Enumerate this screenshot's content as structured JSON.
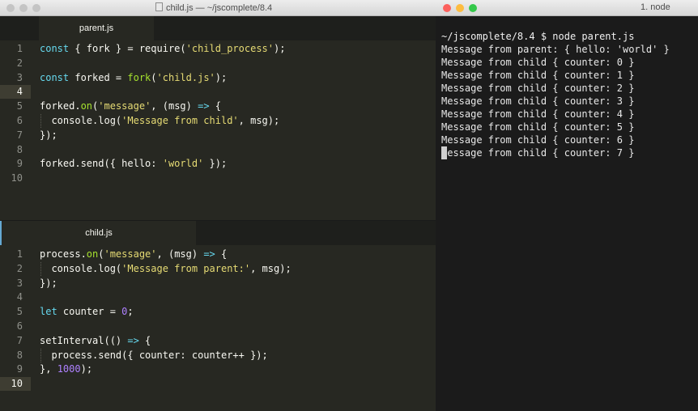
{
  "editor_window": {
    "title": "child.js — ~/jscomplete/8.4",
    "colors": {
      "close": "#fc605c",
      "min": "#fdbc40",
      "max": "#34c84a"
    }
  },
  "terminal_window": {
    "title": "1. node",
    "prompt": "~/jscomplete/8.4 $ node parent.js",
    "lines": [
      "Message from parent: { hello: 'world' }",
      "Message from child { counter: 0 }",
      "Message from child { counter: 1 }",
      "Message from child { counter: 2 }",
      "Message from child { counter: 3 }",
      "Message from child { counter: 4 }",
      "Message from child { counter: 5 }",
      "Message from child { counter: 6 }",
      "Message from child { counter: 7 }"
    ]
  },
  "panes": [
    {
      "tab": "parent.js",
      "active_line": 4,
      "line_numbers": [
        "1",
        "2",
        "3",
        "4",
        "5",
        "6",
        "7",
        "8",
        "9",
        "10"
      ],
      "lines": [
        "const { fork } = require('child_process');",
        "",
        "const forked = fork('child.js');",
        "",
        "forked.on('message', (msg) => {",
        "  console.log('Message from child', msg);",
        "});",
        "",
        "forked.send({ hello: 'world' });",
        ""
      ]
    },
    {
      "tab": "child.js",
      "active_line": 10,
      "line_numbers": [
        "1",
        "2",
        "3",
        "4",
        "5",
        "6",
        "7",
        "8",
        "9",
        "10"
      ],
      "lines": [
        "process.on('message', (msg) => {",
        "  console.log('Message from parent:', msg);",
        "});",
        "",
        "let counter = 0;",
        "",
        "setInterval(() => {",
        "  process.send({ counter: counter++ });",
        "}, 1000);",
        ""
      ]
    }
  ]
}
